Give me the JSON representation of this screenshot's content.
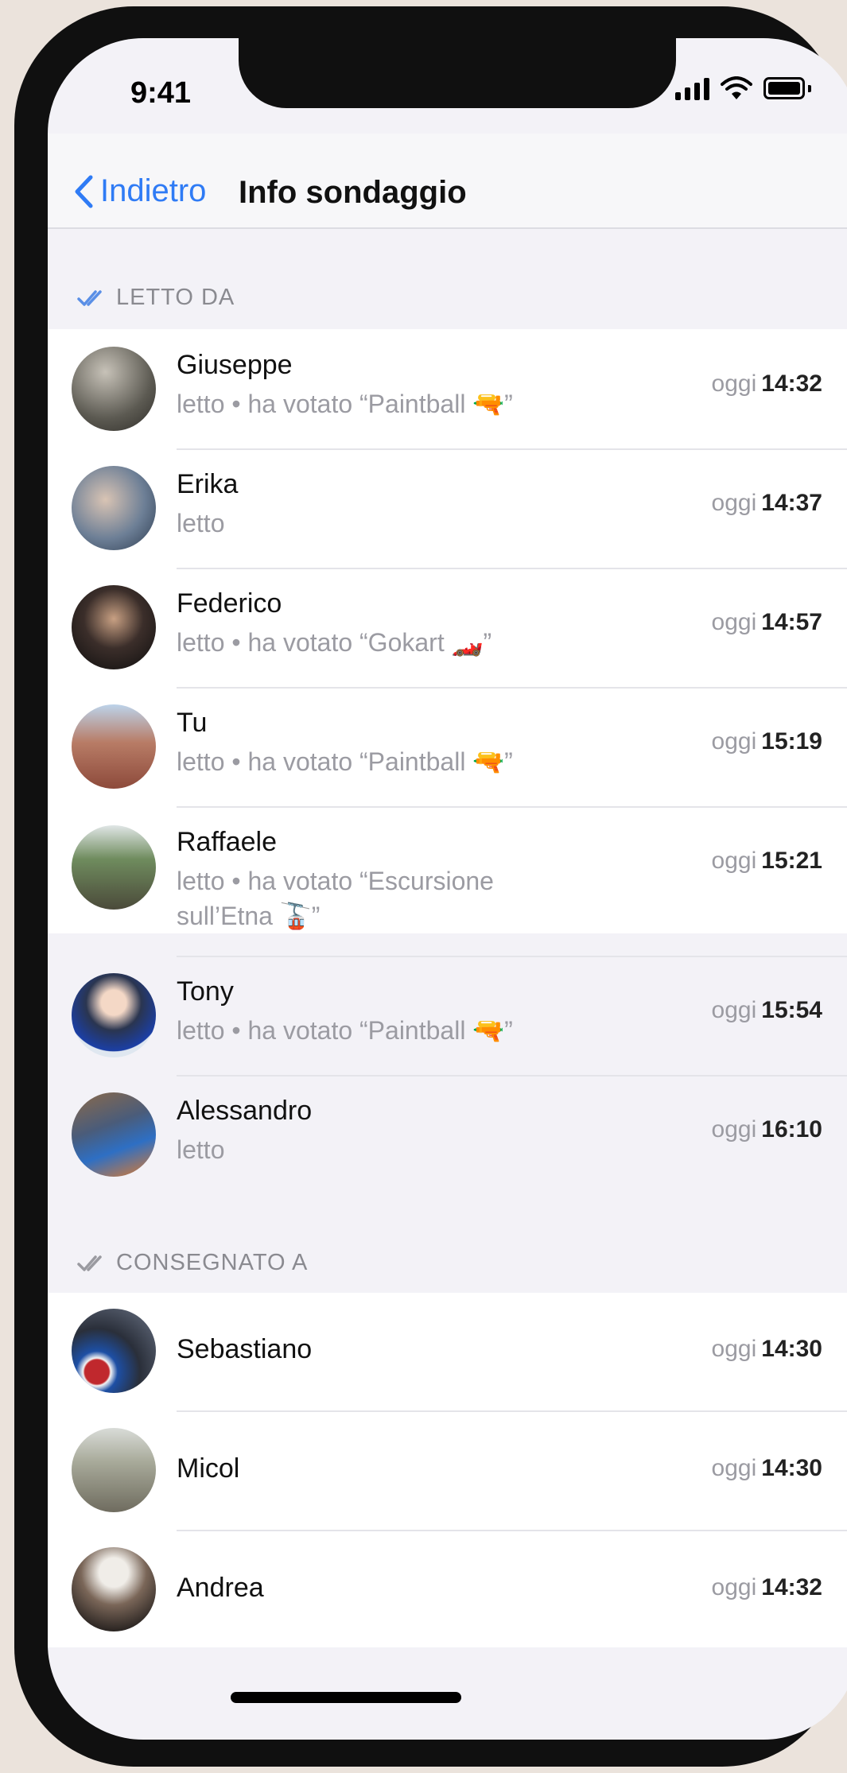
{
  "status": {
    "time": "9:41"
  },
  "nav": {
    "back_label": "Indietro",
    "title": "Info sondaggio"
  },
  "sections": {
    "read": {
      "label": "LETTO DA",
      "rows": [
        {
          "name": "Giuseppe",
          "sub": "letto • ha votato “Paintball 🔫”",
          "day": "oggi",
          "time": "14:32"
        },
        {
          "name": "Erika",
          "sub": "letto",
          "day": "oggi",
          "time": "14:37"
        },
        {
          "name": "Federico",
          "sub": "letto • ha votato “Gokart 🏎️”",
          "day": "oggi",
          "time": "14:57"
        },
        {
          "name": "Tu",
          "sub": "letto • ha votato “Paintball 🔫”",
          "day": "oggi",
          "time": "15:19"
        },
        {
          "name": "Raffaele",
          "sub": "letto • ha votato “Escursione sull’Etna 🚡”",
          "day": "oggi",
          "time": "15:21"
        },
        {
          "name": "Tony",
          "sub": "letto • ha votato “Paintball 🔫”",
          "day": "oggi",
          "time": "15:54"
        },
        {
          "name": "Alessandro",
          "sub": "letto",
          "day": "oggi",
          "time": "16:10"
        }
      ]
    },
    "delivered": {
      "label": "CONSEGNATO A",
      "rows": [
        {
          "name": "Sebastiano",
          "day": "oggi",
          "time": "14:30"
        },
        {
          "name": "Micol",
          "day": "oggi",
          "time": "14:30"
        },
        {
          "name": "Andrea",
          "day": "oggi",
          "time": "14:32"
        }
      ]
    }
  },
  "colors": {
    "accent": "#2f7bf5",
    "read_check": "#5a8fe6",
    "delivered_check": "#9a9aa0"
  }
}
